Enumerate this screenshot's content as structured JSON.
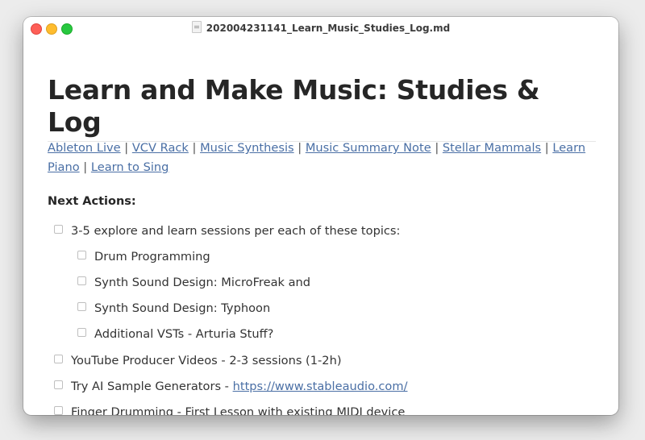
{
  "window": {
    "title": "202004231141_Learn_Music_Studies_Log.md"
  },
  "document": {
    "heading": "Learn and Make Music: Studies & Log",
    "links": [
      {
        "label": "Ableton Live"
      },
      {
        "label": "VCV Rack"
      },
      {
        "label": "Music Synthesis"
      },
      {
        "label": "Music Summary Note"
      },
      {
        "label": "Stellar Mammals"
      },
      {
        "label": "Learn Piano"
      },
      {
        "label": "Learn to Sing"
      }
    ],
    "link_separator": "|",
    "section_label": "Next Actions:",
    "tasks": [
      {
        "text": "3-5 explore and learn sessions per each of these topics:",
        "checked": false
      },
      {
        "text": "Drum Programming",
        "checked": false
      },
      {
        "text": "Synth Sound Design: MicroFreak and",
        "checked": false
      },
      {
        "text": "Synth Sound Design: Typhoon",
        "checked": false
      },
      {
        "text": "Additional VSTs - Arturia Stuff?",
        "checked": false
      },
      {
        "text": "YouTube Producer Videos - 2-3 sessions (1-2h)",
        "checked": false
      },
      {
        "text": "Try AI Sample Generators - ",
        "link": "https://www.stableaudio.com/",
        "checked": false
      },
      {
        "text": "Finger Drumming - First Lesson with existing MIDI device",
        "checked": false
      }
    ]
  },
  "colors": {
    "link": "#4a6fa5",
    "heading": "#262626",
    "close": "#fe5f57",
    "minimize": "#febc2e",
    "maximize": "#28c840"
  }
}
